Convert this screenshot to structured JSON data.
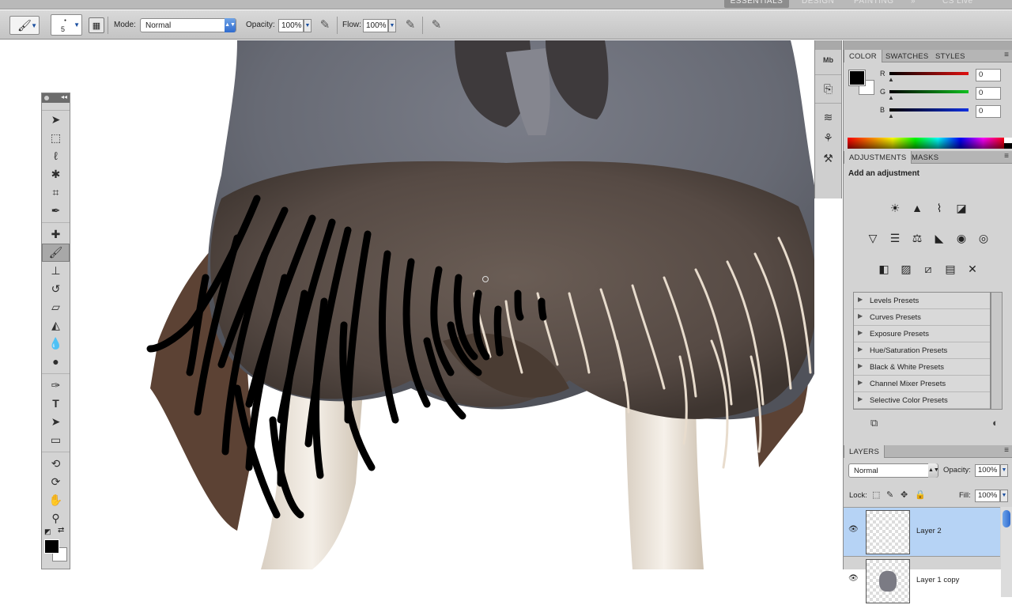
{
  "workspace": {
    "essentials": "ESSENTIALS",
    "design": "DESIGN",
    "painting": "PAINTING",
    "more": "»",
    "cs_live": "CS Live"
  },
  "options_bar": {
    "brush_size": "5",
    "mode_label": "Mode:",
    "mode_value": "Normal",
    "opacity_label": "Opacity:",
    "opacity_value": "100%",
    "flow_label": "Flow:",
    "flow_value": "100%"
  },
  "color_panel": {
    "tabs": [
      "COLOR",
      "SWATCHES",
      "STYLES"
    ],
    "channels": [
      {
        "name": "R",
        "value": "0",
        "color": "#e01010"
      },
      {
        "name": "G",
        "value": "0",
        "color": "#10c020"
      },
      {
        "name": "B",
        "value": "0",
        "color": "#1030e0"
      }
    ],
    "foreground": "#000000",
    "background": "#ffffff"
  },
  "adjustments_panel": {
    "tabs": [
      "ADJUSTMENTS",
      "MASKS"
    ],
    "title": "Add an adjustment",
    "presets": [
      "Levels Presets",
      "Curves Presets",
      "Exposure Presets",
      "Hue/Saturation Presets",
      "Black & White Presets",
      "Channel Mixer Presets",
      "Selective Color Presets"
    ]
  },
  "layers_panel": {
    "tab": "LAYERS",
    "blend_mode": "Normal",
    "opacity_label": "Opacity:",
    "opacity_value": "100%",
    "lock_label": "Lock:",
    "fill_label": "Fill:",
    "fill_value": "100%",
    "layers": [
      {
        "name": "Layer 2",
        "selected": true
      },
      {
        "name": "Layer 1 copy",
        "selected": false
      }
    ]
  },
  "canvas": {
    "subject": "walrus face with painted black whiskers"
  }
}
